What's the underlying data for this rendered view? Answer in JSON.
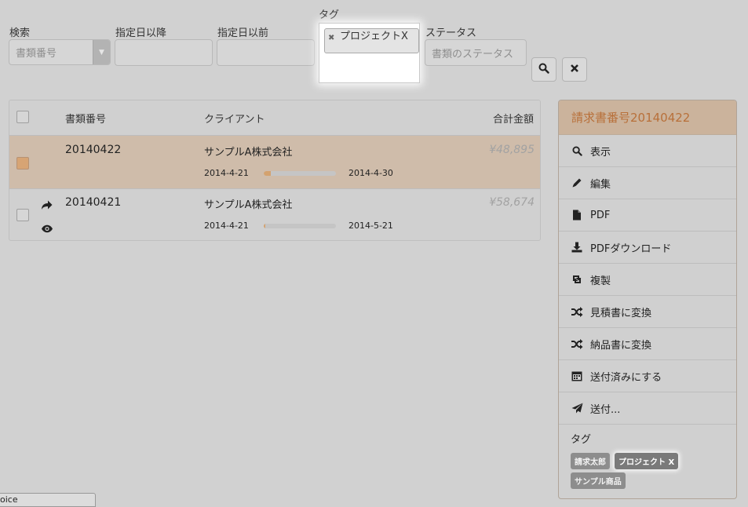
{
  "filters": {
    "search_label": "検索",
    "search_placeholder": "書類番号",
    "date_after_label": "指定日以降",
    "date_after_value": "",
    "date_before_label": "指定日以前",
    "date_before_value": "",
    "tag_label": "タグ",
    "tag_selected": "プロジェクトX",
    "status_label": "ステータス",
    "status_placeholder": "書類のステータス"
  },
  "buttons": {
    "search_icon": "search-icon",
    "clear_icon": "close-icon"
  },
  "table": {
    "headers": {
      "number": "書類番号",
      "client": "クライアント",
      "total": "合計金額"
    },
    "rows": [
      {
        "number": "20140422",
        "client": "サンプルA株式会社",
        "start": "2014-4-21",
        "end": "2014-4-30",
        "amount": "¥48,895",
        "progress": 0.1,
        "selected": true
      },
      {
        "number": "20140421",
        "client": "サンプルA株式会社",
        "start": "2014-4-21",
        "end": "2014-5-21",
        "amount": "¥58,674",
        "progress": 0.02,
        "selected": false
      }
    ]
  },
  "panel": {
    "title": "請求書番号20140422",
    "actions": [
      {
        "label": "表示",
        "icon": "search-icon"
      },
      {
        "label": "編集",
        "icon": "pencil-icon"
      },
      {
        "label": "PDF",
        "icon": "file-icon"
      },
      {
        "label": "PDFダウンロード",
        "icon": "download-icon"
      },
      {
        "label": "複製",
        "icon": "retweet-icon"
      },
      {
        "label": "見積書に変換",
        "icon": "shuffle-icon"
      },
      {
        "label": "納品書に変換",
        "icon": "shuffle-icon"
      },
      {
        "label": "送付済みにする",
        "icon": "calendar-icon"
      },
      {
        "label": "送付...",
        "icon": "send-icon"
      }
    ],
    "tags_label": "タグ",
    "tags": [
      "請求太郎",
      "プロジェクト X",
      "サンプル商品"
    ]
  },
  "statusbar": {
    "text": "oice"
  },
  "colors": {
    "accent": "#b8703a",
    "selected_row": "#cfbcaa",
    "progress": "#d4a26f"
  }
}
